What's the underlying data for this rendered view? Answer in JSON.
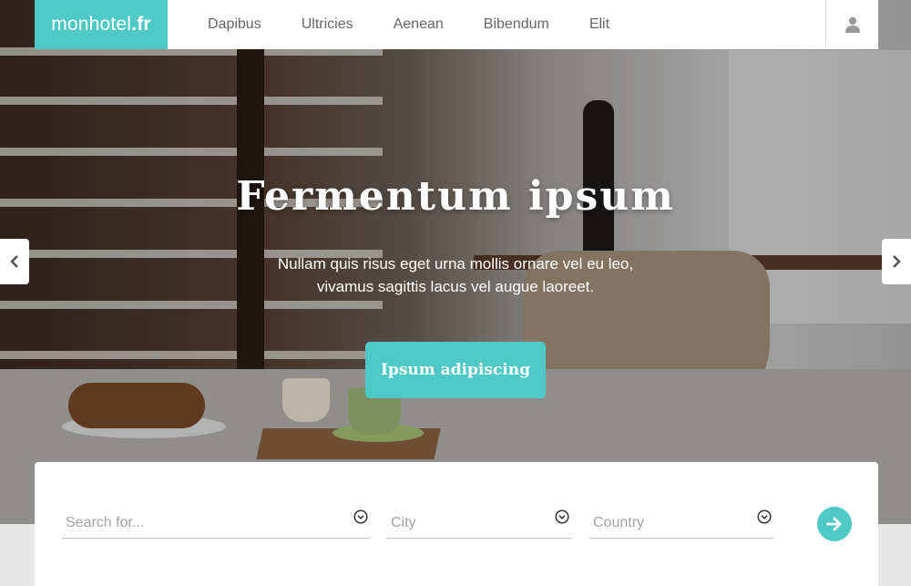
{
  "brand": {
    "name": "monhotel",
    "tld": ".fr"
  },
  "nav": {
    "items": [
      "Dapibus",
      "Ultricies",
      "Aenean",
      "Bibendum",
      "Elit"
    ]
  },
  "hero": {
    "title": "Fermentum ipsum",
    "subtitle_line1": "Nullam quis risus eget urna mollis ornare vel eu leo,",
    "subtitle_line2": "vivamus sagittis lacus vel augue laoreet.",
    "cta_label": "Ipsum adipiscing"
  },
  "search": {
    "query_placeholder": "Search for...",
    "city_placeholder": "City",
    "country_placeholder": "Country"
  },
  "icons": {
    "user": "user-icon",
    "prev": "chevron-left-icon",
    "next": "chevron-right-icon",
    "dropdown": "chevron-down-circle-icon",
    "submit": "arrow-right-icon"
  },
  "colors": {
    "accent": "#4fc9c6",
    "nav_text": "#666666",
    "panel": "#ffffff"
  }
}
